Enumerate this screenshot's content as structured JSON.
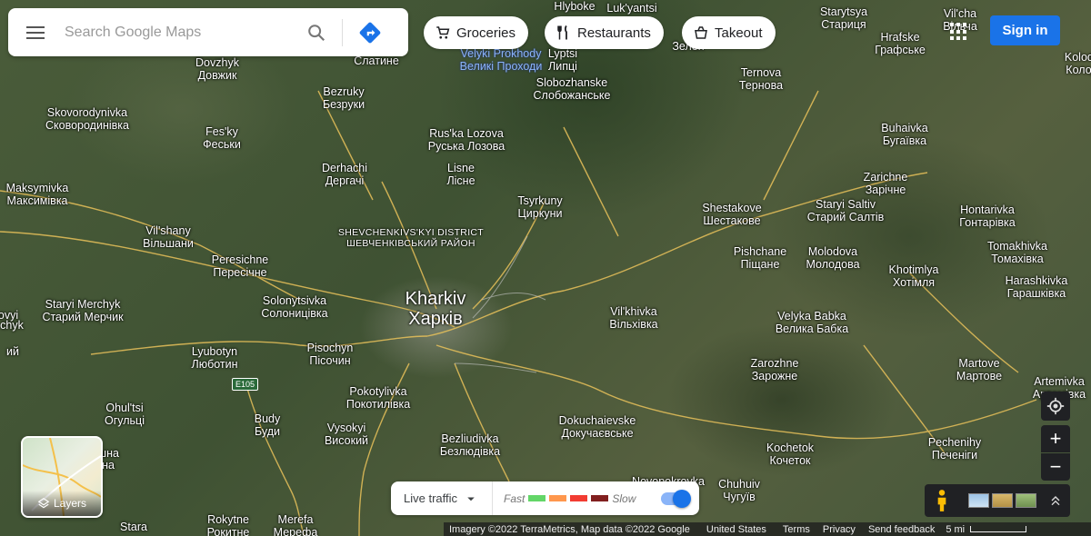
{
  "search": {
    "placeholder": "Search Google Maps"
  },
  "chips": [
    {
      "label": "Groceries",
      "icon": "cart-icon"
    },
    {
      "label": "Restaurants",
      "icon": "fork-knife-icon"
    },
    {
      "label": "Takeout",
      "icon": "takeout-icon"
    }
  ],
  "account": {
    "sign_in": "Sign in"
  },
  "layers": {
    "label": "Layers"
  },
  "traffic": {
    "mode": "Live traffic",
    "fast": "Fast",
    "slow": "Slow",
    "colors": [
      "#63d668",
      "#ff974d",
      "#f23c32",
      "#811f1f"
    ],
    "enabled": true
  },
  "footer": {
    "imagery": "Imagery ©2022 TerraMetrics, Map data ©2022 Google",
    "country": "United States",
    "terms": "Terms",
    "privacy": "Privacy",
    "feedback": "Send feedback",
    "scale": "5 mi"
  },
  "highway": "E105",
  "places": [
    {
      "en": "Kharkiv",
      "local": "Харків",
      "major": true
    },
    {
      "en": "SHEVCHENKIVS'KYI DISTRICT",
      "local": "ШЕВЧЕНКІВСЬКИЙ РАЙОН",
      "district": true
    },
    {
      "en": "Dovzhyk",
      "local": "Довжик"
    },
    {
      "en": "",
      "local": "Слатине"
    },
    {
      "en": "Velyki Prokhody",
      "local": "Великі Проходи",
      "blue": true
    },
    {
      "en": "Lyptsi",
      "local": "Липці"
    },
    {
      "en": "Slobozhanske",
      "local": "Слобожанське"
    },
    {
      "en": "Hlyboke",
      "local": ""
    },
    {
      "en": "Luk'yantsi",
      "local": ""
    },
    {
      "en": "Starytsya",
      "local": "Стариця"
    },
    {
      "en": "Hrafske",
      "local": "Графське"
    },
    {
      "en": "Vil'cha",
      "local": "Вільча"
    },
    {
      "en": "Kolody",
      "local": "Колод"
    },
    {
      "en": "Ternova",
      "local": "Тернова"
    },
    {
      "en": "Bezruky",
      "local": "Безруки"
    },
    {
      "en": "Skovorodynivka",
      "local": "Сковородинівка"
    },
    {
      "en": "Fes'ky",
      "local": "Феськи"
    },
    {
      "en": "Rus'ka Lozova",
      "local": "Руська Лозова"
    },
    {
      "en": "Buhaivka",
      "local": "Бугаївка"
    },
    {
      "en": "Derhachi",
      "local": "Дергачі"
    },
    {
      "en": "Lisne",
      "local": "Лісне"
    },
    {
      "en": "Zarichne",
      "local": "Зарічне"
    },
    {
      "en": "Maksymivka",
      "local": "Максимівка"
    },
    {
      "en": "Tsyrkuny",
      "local": "Циркуни"
    },
    {
      "en": "Shestakove",
      "local": "Шестакове"
    },
    {
      "en": "Staryi Saltiv",
      "local": "Старий Салтів"
    },
    {
      "en": "Hontarivka",
      "local": "Гонтарівка"
    },
    {
      "en": "Vil'shany",
      "local": "Вільшани"
    },
    {
      "en": "Tomakhivka",
      "local": "Томахівка"
    },
    {
      "en": "Pishchane",
      "local": "Піщане"
    },
    {
      "en": "Molodova",
      "local": "Молодова"
    },
    {
      "en": "Peresichne",
      "local": "Пересічне"
    },
    {
      "en": "Khotimlya",
      "local": "Хотімля"
    },
    {
      "en": "Harashkivka",
      "local": "Гарашківка"
    },
    {
      "en": "Solonytsivka",
      "local": "Солоницівка"
    },
    {
      "en": "Staryi Merchyk",
      "local": "Старий Мерчик"
    },
    {
      "en": "Vil'khivka",
      "local": "Вільхівка"
    },
    {
      "en": "Velyka Babka",
      "local": "Велика Бабка"
    },
    {
      "en": "Pisochyn",
      "local": "Пісочин"
    },
    {
      "en": "Lyubotyn",
      "local": "Люботин"
    },
    {
      "en": "Zarozhne",
      "local": "Зарожне"
    },
    {
      "en": "Martove",
      "local": "Мартове"
    },
    {
      "en": "Artemivka",
      "local": "Артемівка"
    },
    {
      "en": "Pokotylivka",
      "local": "Покотилівка"
    },
    {
      "en": "Ohul'tsi",
      "local": "Огульці"
    },
    {
      "en": "Dokuchaievske",
      "local": "Докучаєвське"
    },
    {
      "en": "Budy",
      "local": "Буди"
    },
    {
      "en": "Vysokyi",
      "local": "Високий"
    },
    {
      "en": "Bezliudivka",
      "local": "Безлюдівка"
    },
    {
      "en": "Kochetok",
      "local": "Кочеток"
    },
    {
      "en": "Pechenihy",
      "local": "Печеніги"
    },
    {
      "en": "Novopokrovka",
      "local": ""
    },
    {
      "en": "Chuhuiv",
      "local": "Чугуїв"
    },
    {
      "en": "Rokytne",
      "local": "Рокитне"
    },
    {
      "en": "Merefa",
      "local": "Мерефа"
    },
    {
      "en": "Stara",
      "local": ""
    },
    {
      "en": "",
      "local": "шна"
    },
    {
      "en": "",
      "local": "на"
    },
    {
      "en": "ovyi",
      "local": ""
    },
    {
      "en": "chyk",
      "local": ""
    },
    {
      "en": "",
      "local": "ий"
    },
    {
      "en": "",
      "local": "Зелен"
    }
  ]
}
